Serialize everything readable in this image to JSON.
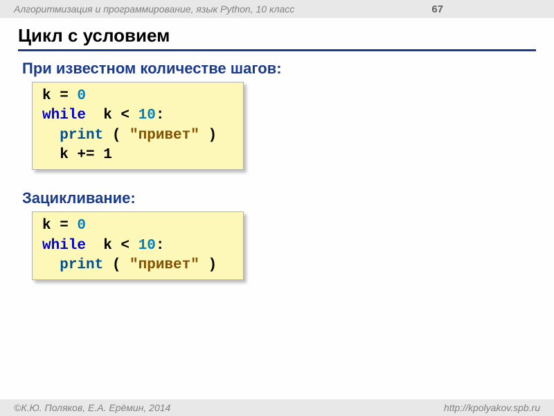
{
  "header": {
    "course": "Алгоритмизация и программирование, язык Python, 10 класс",
    "page": "67"
  },
  "title": "Цикл с условием",
  "section1": {
    "heading": "При известном количестве шагов:",
    "code": {
      "l1a": "k = ",
      "l1b": "0",
      "l2a": "while",
      "l2b": "  k < ",
      "l2c": "10",
      "l2d": ":",
      "l3a": "  ",
      "l3b": "print",
      "l3c": " ( ",
      "l3d": "\"привет\"",
      "l3e": " )",
      "l4": "  k += 1"
    }
  },
  "section2": {
    "heading": "Зацикливание:",
    "code": {
      "l1a": "k = ",
      "l1b": "0",
      "l2a": "while",
      "l2b": "  k < ",
      "l2c": "10",
      "l2d": ":",
      "l3a": "  ",
      "l3b": "print",
      "l3c": " ( ",
      "l3d": "\"привет\"",
      "l3e": " )"
    }
  },
  "footer": {
    "authors": "©К.Ю. Поляков, Е.А. Ерёмин, 2014",
    "url": "http://kpolyakov.spb.ru"
  }
}
